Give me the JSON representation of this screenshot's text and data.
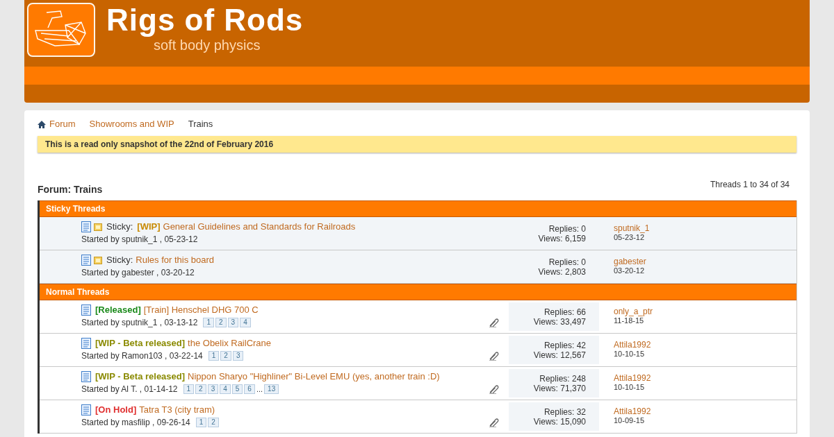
{
  "header": {
    "logo_title": "Rigs of Rods",
    "logo_subtitle": "soft body physics"
  },
  "breadcrumb": [
    {
      "label": "Forum",
      "kind": "home"
    },
    {
      "label": "Showrooms and WIP",
      "kind": "link"
    },
    {
      "label": "Trains",
      "kind": "current"
    }
  ],
  "notice": "This is a read only snapshot of the 22nd of February 2016",
  "forum_title": "Forum: Trains",
  "thread_count": "Threads 1 to 34 of 34",
  "sections": [
    {
      "title": "Sticky Threads",
      "threads": [
        {
          "sticky_label": "Sticky:",
          "prefix": {
            "text": "[WIP]",
            "color": "#c88a00"
          },
          "title": "General Guidelines and Standards for Railroads",
          "started": "Started by sputnik_1 , 05-23-12",
          "attachment": false,
          "replies": "Replies: 0",
          "views": "Views: 6,159",
          "last_user": "sputnik_1",
          "last_date": "05-23-12"
        },
        {
          "sticky_label": "Sticky:",
          "title": "Rules for this board",
          "started": "Started by gabester , 03-20-12",
          "attachment": false,
          "replies": "Replies: 0",
          "views": "Views: 2,803",
          "last_user": "gabester",
          "last_date": "03-20-12"
        }
      ]
    },
    {
      "title": "Normal Threads",
      "threads": [
        {
          "prefix": {
            "text": "[Released]",
            "color": "#1a8a1a"
          },
          "title": "[Train] Henschel DHG 700 C",
          "started": "Started by sputnik_1 , 03-13-12",
          "pages": [
            "1",
            "2",
            "3",
            "4"
          ],
          "attachment": true,
          "replies": "Replies: 66",
          "views": "Views: 33,497",
          "last_user": "only_a_ptr",
          "last_date": "11-18-15"
        },
        {
          "prefix": {
            "text": "[WIP - Beta released]",
            "color": "#8a8a00"
          },
          "title": "the Obelix RailCrane",
          "started": "Started by Ramon103 , 03-22-14",
          "pages": [
            "1",
            "2",
            "3"
          ],
          "attachment": true,
          "replies": "Replies: 42",
          "views": "Views: 12,567",
          "last_user": "Attila1992",
          "last_date": "10-10-15"
        },
        {
          "prefix": {
            "text": "[WIP - Beta released]",
            "color": "#8a8a00"
          },
          "title": "Nippon Sharyo \"Highliner\" Bi-Level EMU (yes, another train :D)",
          "started": "Started by Al T. , 01-14-12",
          "pages": [
            "1",
            "2",
            "3",
            "4",
            "5",
            "6",
            "...",
            "13"
          ],
          "attachment": true,
          "replies": "Replies: 248",
          "views": "Views: 71,370",
          "last_user": "Attila1992",
          "last_date": "10-10-15"
        },
        {
          "prefix": {
            "text": "[On Hold]",
            "color": "#e03030"
          },
          "title": "Tatra T3 (city tram)",
          "started": "Started by masfilip , 09-26-14",
          "pages": [
            "1",
            "2"
          ],
          "attachment": true,
          "replies": "Replies: 32",
          "views": "Views: 15,090",
          "last_user": "Attila1992",
          "last_date": "10-09-15"
        }
      ]
    }
  ]
}
